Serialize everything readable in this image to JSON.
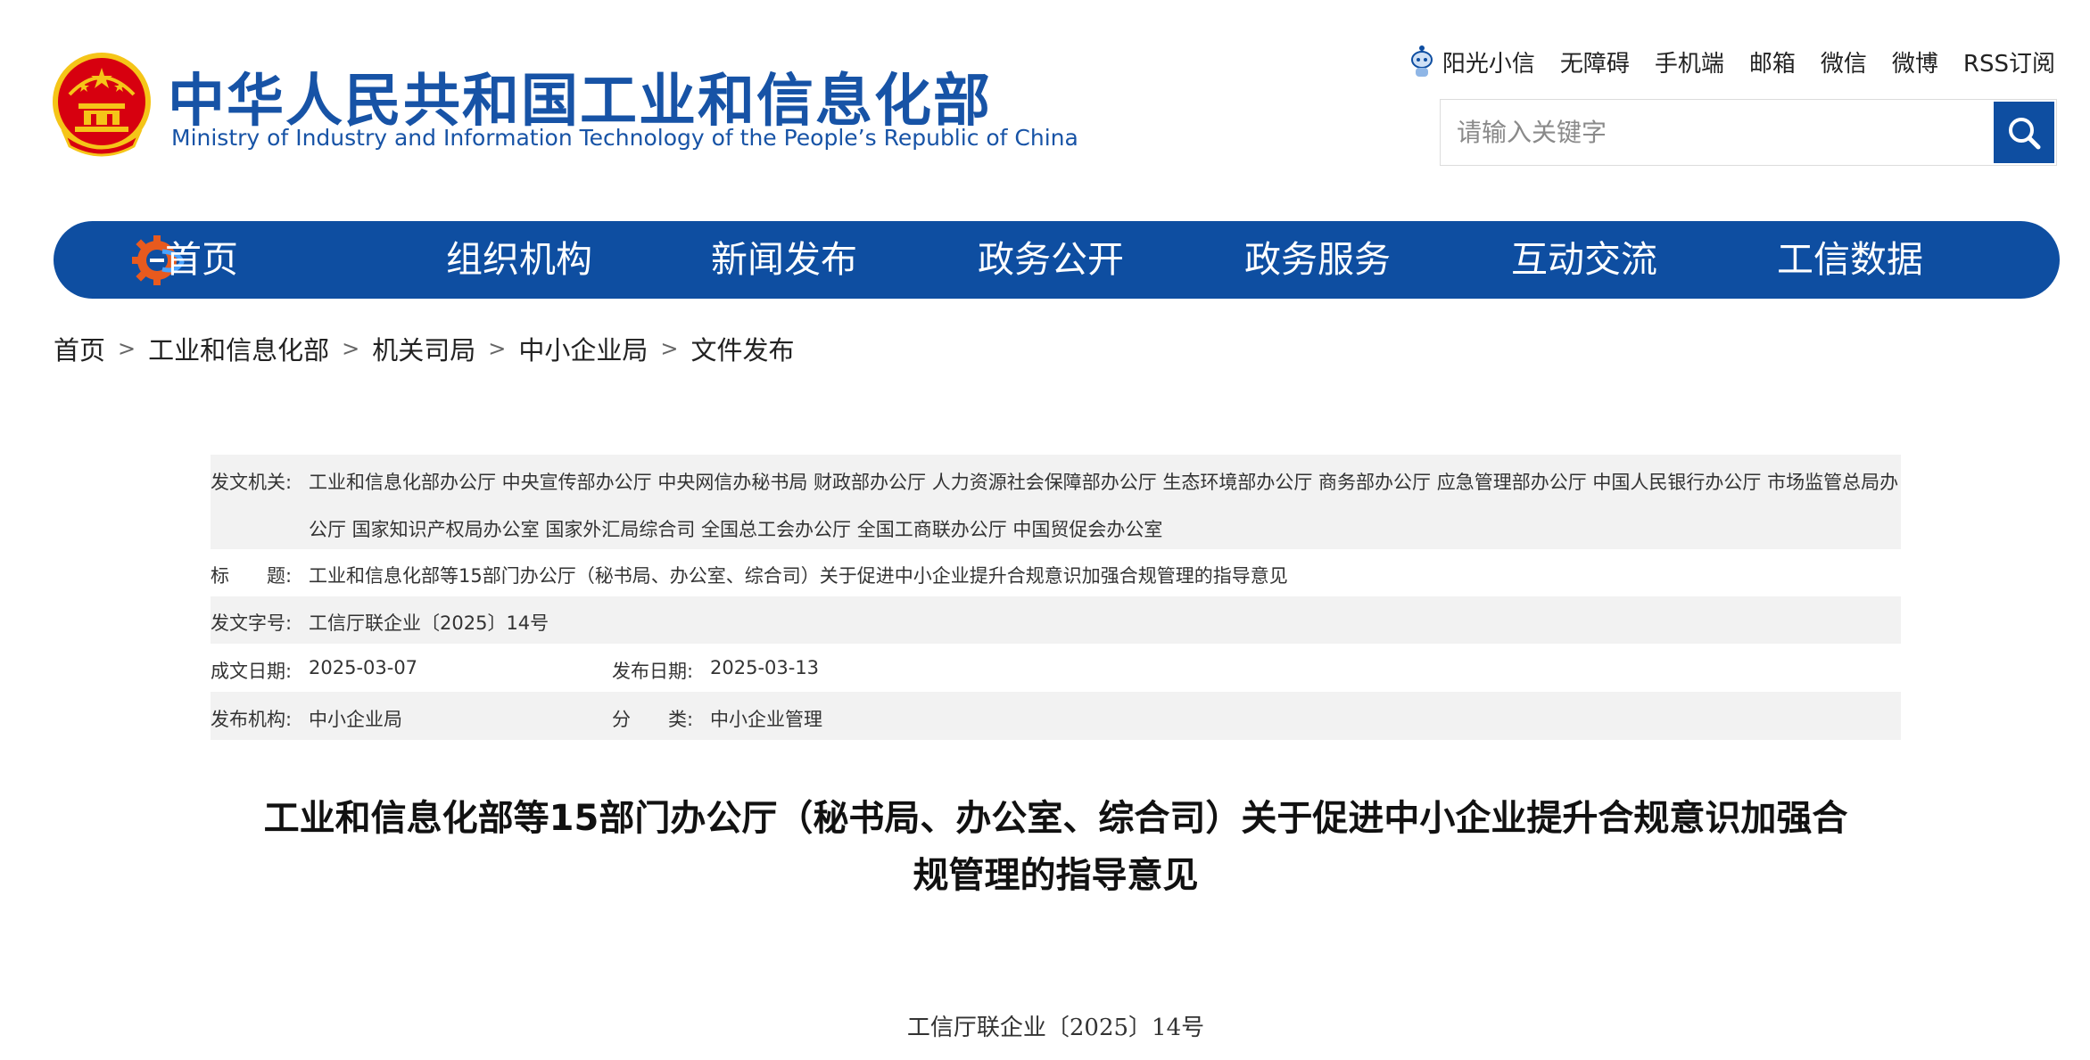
{
  "header": {
    "title_cn": "中华人民共和国工业和信息化部",
    "title_en": "Ministry of Industry and Information Technology of the People’s Republic of China",
    "top_links": [
      "阳光小信",
      "无障碍",
      "手机端",
      "邮箱",
      "微信",
      "微博",
      "RSS订阅"
    ],
    "search_placeholder": "请输入关键字"
  },
  "nav": {
    "items": [
      "首页",
      "组织机构",
      "新闻发布",
      "政务公开",
      "政务服务",
      "互动交流",
      "工信数据"
    ]
  },
  "breadcrumb": [
    "首页",
    "工业和信息化部",
    "机关司局",
    "中小企业局",
    "文件发布"
  ],
  "meta": {
    "issuer_label": "发文机关:",
    "issuer_line1": "工业和信息化部办公厅 中央宣传部办公厅 中央网信办秘书局 财政部办公厅 人力资源社会保障部办公厅 生态环境部办公厅 商务部办公厅 应急管理部办公厅 中国人民银行办公厅 市场监管总局办",
    "issuer_line2": "公厅 国家知识产权局办公室 国家外汇局综合司 全国总工会办公厅 全国工商联办公厅 中国贸促会办公室",
    "title_label": "标　　题:",
    "title_value": "工业和信息化部等15部门办公厅（秘书局、办公室、综合司）关于促进中小企业提升合规意识加强合规管理的指导意见",
    "doc_no_label": "发文字号:",
    "doc_no_value": "工信厅联企业〔2025〕14号",
    "written_date_label": "成文日期:",
    "written_date_value": "2025-03-07",
    "publish_date_label": "发布日期:",
    "publish_date_value": "2025-03-13",
    "publisher_label": "发布机构:",
    "publisher_value": "中小企业局",
    "category_label": "分　　类:",
    "category_value": "中小企业管理"
  },
  "article": {
    "title_line1": "工业和信息化部等15部门办公厅（秘书局、办公室、综合司）关于促进中小企业提升合规意识加强合",
    "title_line2": "规管理的指导意见",
    "doc_number": "工信厅联企业〔2025〕14号"
  },
  "colors": {
    "brand_blue": "#0e4ea1",
    "title_blue": "#1753a6",
    "emblem_red": "#d7000f",
    "emblem_gold": "#f5c518",
    "meta_row_grey": "#f2f2f2"
  },
  "icons": {
    "emblem": "national-emblem-icon",
    "robot": "robot-assistant-icon",
    "search": "search-icon",
    "nav_logo": "miit-gear-logo-icon"
  }
}
